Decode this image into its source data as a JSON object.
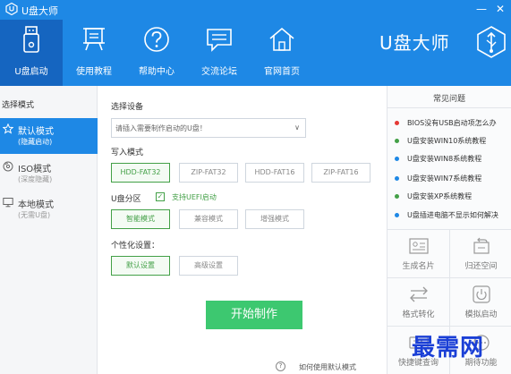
{
  "window": {
    "title": "U盘大师",
    "minimize": "—",
    "close": "✕"
  },
  "nav": [
    {
      "label": "U盘启动",
      "icon": "usb-icon",
      "active": true
    },
    {
      "label": "使用教程",
      "icon": "easel-icon",
      "active": false
    },
    {
      "label": "帮助中心",
      "icon": "question-icon",
      "active": false
    },
    {
      "label": "交流论坛",
      "icon": "chat-icon",
      "active": false
    },
    {
      "label": "官网首页",
      "icon": "home-icon",
      "active": false
    }
  ],
  "brand": {
    "text": "U盘大师"
  },
  "sidebar": {
    "title": "选择模式",
    "modes": [
      {
        "name": "默认模式",
        "sub": "(隐藏启动)",
        "icon": "star-icon",
        "active": true
      },
      {
        "name": "ISO模式",
        "sub": "(深度隐藏)",
        "icon": "disc-icon",
        "active": false
      },
      {
        "name": "本地模式",
        "sub": "(无需U盘)",
        "icon": "monitor-icon",
        "active": false
      }
    ]
  },
  "main": {
    "device_label": "选择设备",
    "device_placeholder": "请插入需要制作启动的U盘！",
    "write_mode_label": "写入模式",
    "write_modes": [
      "HDD-FAT32",
      "ZIP-FAT32",
      "HDD-FAT16",
      "ZIP-FAT16"
    ],
    "partition_label": "U盘分区",
    "uefi_label": "支持UEFI启动",
    "uefi_check": "✓",
    "partition_modes": [
      "智能模式",
      "兼容模式",
      "增强模式"
    ],
    "personal_label": "个性化设置：",
    "personal_options": [
      "默认设置",
      "高级设置"
    ],
    "start_button": "开始制作",
    "help_icon": "?",
    "help_text": "如何使用默认模式"
  },
  "faq": {
    "title": "常见问题",
    "items": [
      {
        "text": "BIOS没有USB启动项怎么办",
        "color": "#e53935"
      },
      {
        "text": "U盘安装WIN10系统教程",
        "color": "#43a047"
      },
      {
        "text": "U盘安装WIN8系统教程",
        "color": "#1e88e5"
      },
      {
        "text": "U盘安装WIN7系统教程",
        "color": "#1e88e5"
      },
      {
        "text": "U盘安装XP系统教程",
        "color": "#43a047"
      },
      {
        "text": "U盘插进电脑不显示如何解决",
        "color": "#1e88e5"
      }
    ]
  },
  "tools": [
    {
      "label": "生成名片",
      "icon": "card-icon"
    },
    {
      "label": "归还空间",
      "icon": "return-icon"
    },
    {
      "label": "格式转化",
      "icon": "swap-icon"
    },
    {
      "label": "模拟启动",
      "icon": "power-icon"
    },
    {
      "label": "快捷键查询",
      "icon": "keyboard-icon"
    },
    {
      "label": "期待功能",
      "icon": "more-icon"
    }
  ],
  "watermark": "最需网",
  "colors": {
    "header": "#1e88e5",
    "header_active": "#1565c0",
    "accent_green": "#3dc870",
    "selected_green": "#43a047"
  }
}
